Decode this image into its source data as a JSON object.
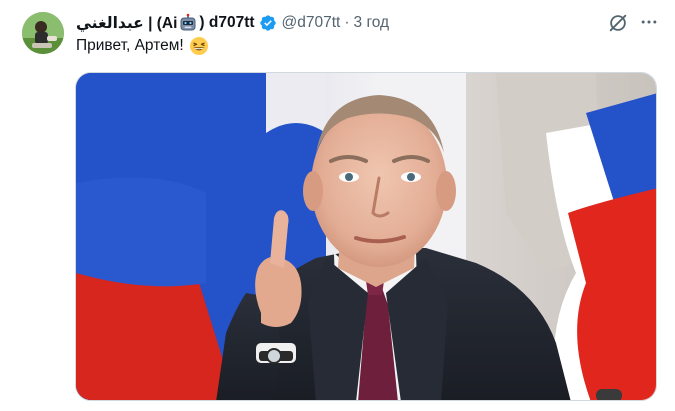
{
  "post": {
    "author": {
      "display_name_prefix": "عبدالغني | (Ai",
      "robot_icon": "robot-face-emoji",
      "display_name_suffix": ") d707tt",
      "verified_icon": "verified-badge-icon",
      "handle": "@d707tt"
    },
    "separator": "·",
    "time": "3 год",
    "text": "Привет, Артем!",
    "text_emoji": "grinning-squinting-face-emoji",
    "icons": {
      "grok": "grok-slash-circle-icon",
      "more": "more-dots-icon"
    },
    "media": {
      "description_icon": "photo"
    }
  },
  "colors": {
    "text_primary": "#0f1419",
    "text_secondary": "#536471",
    "verified_blue": "#1d9bf0",
    "flag_blue": "#1f4fc4",
    "flag_red": "#e0261d"
  }
}
